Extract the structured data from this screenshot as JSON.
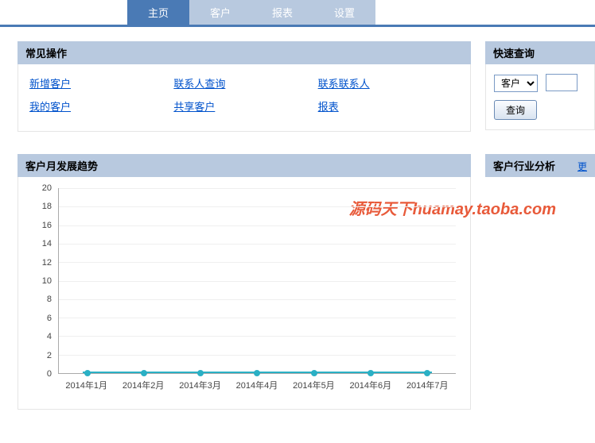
{
  "nav": {
    "tabs": [
      {
        "label": "主页",
        "active": true
      },
      {
        "label": "客户",
        "active": false
      },
      {
        "label": "报表",
        "active": false
      },
      {
        "label": "设置",
        "active": false
      }
    ]
  },
  "common_ops": {
    "title": "常见操作",
    "links": [
      "新增客户",
      "联系人查询",
      "联系联系人",
      "我的客户",
      "共享客户",
      "报表"
    ]
  },
  "quick_query": {
    "title": "快速查询",
    "select_value": "客户",
    "button": "查询"
  },
  "trend": {
    "title": "客户月发展趋势"
  },
  "industry": {
    "title": "客户行业分析",
    "more": "更"
  },
  "watermark": "源码天下huamay.taoba.com",
  "chart_data": {
    "type": "line",
    "categories": [
      "2014年1月",
      "2014年2月",
      "2014年3月",
      "2014年4月",
      "2014年5月",
      "2014年6月",
      "2014年7月"
    ],
    "values": [
      0,
      0,
      0,
      0,
      0,
      0,
      0
    ],
    "y_ticks": [
      0,
      2,
      4,
      6,
      8,
      10,
      12,
      14,
      16,
      18,
      20
    ],
    "ylim": [
      0,
      20
    ],
    "xlabel": "",
    "ylabel": "",
    "title": "客户月发展趋势"
  }
}
